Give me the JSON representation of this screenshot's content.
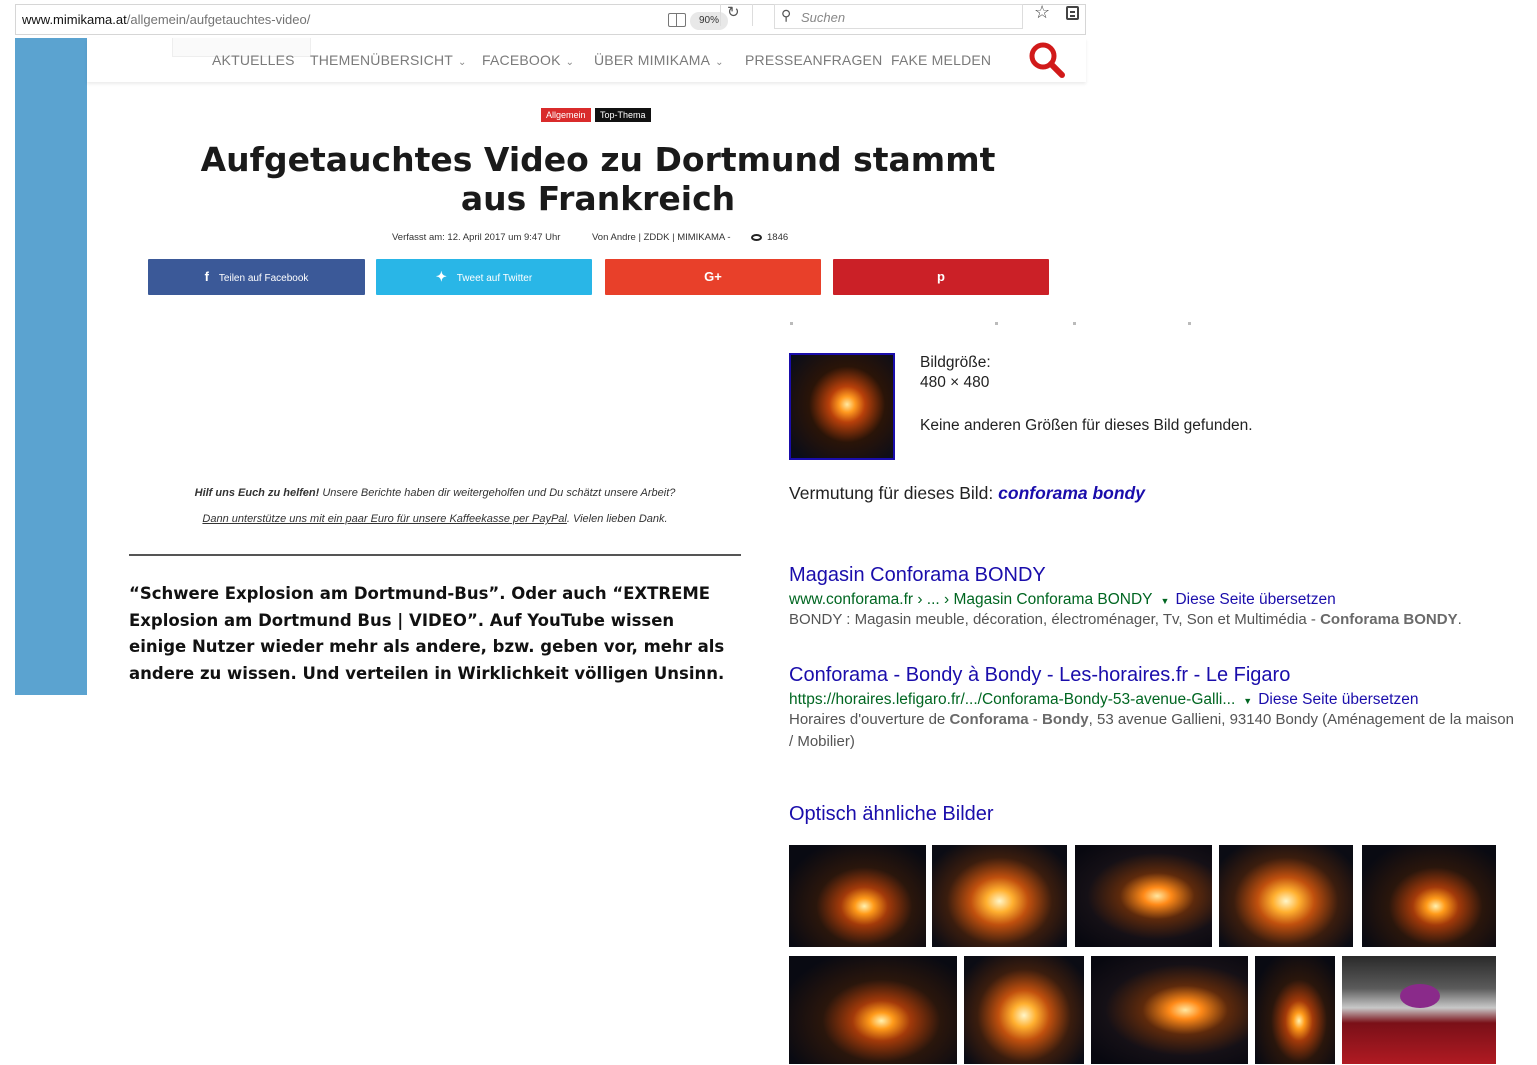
{
  "browser": {
    "url_host": "www.mimikama.at",
    "url_path": "/allgemein/aufgetauchtes-video/",
    "zoom": "90%",
    "search_placeholder": "Suchen"
  },
  "site": {
    "nav": [
      {
        "label": "AKTUELLES"
      },
      {
        "label": "THEMENÜBERSICHT"
      },
      {
        "label": "FACEBOOK"
      },
      {
        "label": "ÜBER MIMIKAMA"
      },
      {
        "label": "PRESSEANFRAGEN"
      },
      {
        "label": "FAKE MELDEN"
      }
    ],
    "tags": [
      "Allgemein",
      "Top-Thema"
    ],
    "headline_line1": "Aufgetauchtes Video zu Dortmund stammt",
    "headline_line2": "aus Frankreich",
    "meta_date": "Verfasst am: 12. April 2017 um 9:47 Uhr",
    "meta_author": "Von Andre | ZDDK | MIMIKAMA -",
    "meta_views": "1846",
    "share": {
      "facebook": "Teilen auf Facebook",
      "twitter": "Tweet auf Twitter",
      "gplus": "G+",
      "pinterest": "p"
    },
    "help_bold": "Hilf uns Euch zu helfen!",
    "help_rest": " Unsere Berichte haben dir weitergeholfen und Du schätzt unsere Arbeit?",
    "help_link": "Dann unterstütze uns mit ein paar Euro für unsere Kaffeekasse per PayPal",
    "help_end": ". Vielen lieben Dank.",
    "lead": "“Schwere Explosion am Dortmund-Bus”. Oder auch “EXTREME Explosion am Dortmund Bus | VIDEO”. Auf YouTube wissen einige Nutzer wieder mehr als andere, bzw. geben vor, mehr als andere zu wissen. Und verteilen in Wirklichkeit völligen Unsinn."
  },
  "google": {
    "size_label": "Bildgröße:",
    "size_value": "480 × 480",
    "no_other_sizes": "Keine anderen Größen für dieses Bild gefunden.",
    "guess_prefix": "Vermutung für dieses Bild: ",
    "guess_value": "conforama bondy",
    "results": [
      {
        "title": "Magasin Conforama BONDY",
        "url": "www.conforama.fr › ... › Magasin Conforama BONDY",
        "translate": "Diese Seite übersetzen",
        "snippet_plain": "BONDY : Magasin meuble, décoration, électroménager, Tv, Son et Multimédia - ",
        "snippet_bold": "Conforama BONDY",
        "snippet_end": "."
      },
      {
        "title": "Conforama - Bondy à Bondy - Les-horaires.fr - Le Figaro",
        "url": "https://horaires.lefigaro.fr/.../Conforama-Bondy-53-avenue-Galli...",
        "translate": "Diese Seite übersetzen",
        "snippet_a": "Horaires d'ouverture de ",
        "snippet_b1": "Conforama",
        "snippet_mid": " - ",
        "snippet_b2": "Bondy",
        "snippet_c": ", 53 avenue Gallieni, 93140 Bondy (Aménagement de la maison / Mobilier)"
      }
    ],
    "similar_heading": "Optisch ähnliche Bilder"
  },
  "colors": {
    "strip": "#5ba3d0",
    "facebook": "#3b5998",
    "twitter": "#29b6e7",
    "gplus": "#e8402a",
    "pinterest": "#cb2027",
    "link": "#1a0dab",
    "url_green": "#006621"
  }
}
